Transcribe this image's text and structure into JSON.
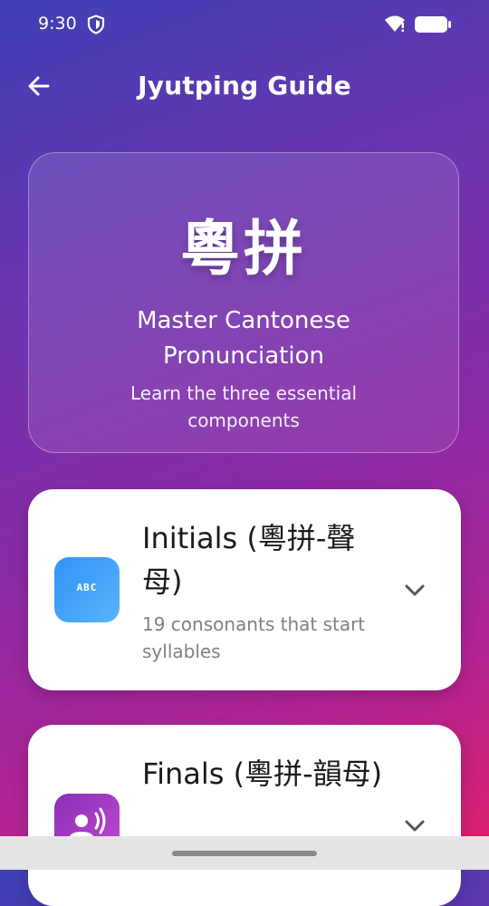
{
  "status": {
    "time": "9:30"
  },
  "header": {
    "title": "Jyutping Guide"
  },
  "hero": {
    "characters": "粵拼",
    "heading": "Master Cantonese Pronunciation",
    "subheading": "Learn the three essential components"
  },
  "sections": [
    {
      "title": "Initials (粵拼-聲母)",
      "description": "19 consonants that start syllables",
      "icon": "abc-icon",
      "color": "#3b9ef7"
    },
    {
      "title": "Finals (粵拼-韻母)",
      "description": "",
      "icon": "voice-icon",
      "color": "#9c39c2"
    }
  ],
  "icons": [
    "shield-icon",
    "wifi-icon",
    "battery-icon",
    "back-arrow-icon",
    "chevron-down-icon"
  ],
  "abc_label": "ABC"
}
